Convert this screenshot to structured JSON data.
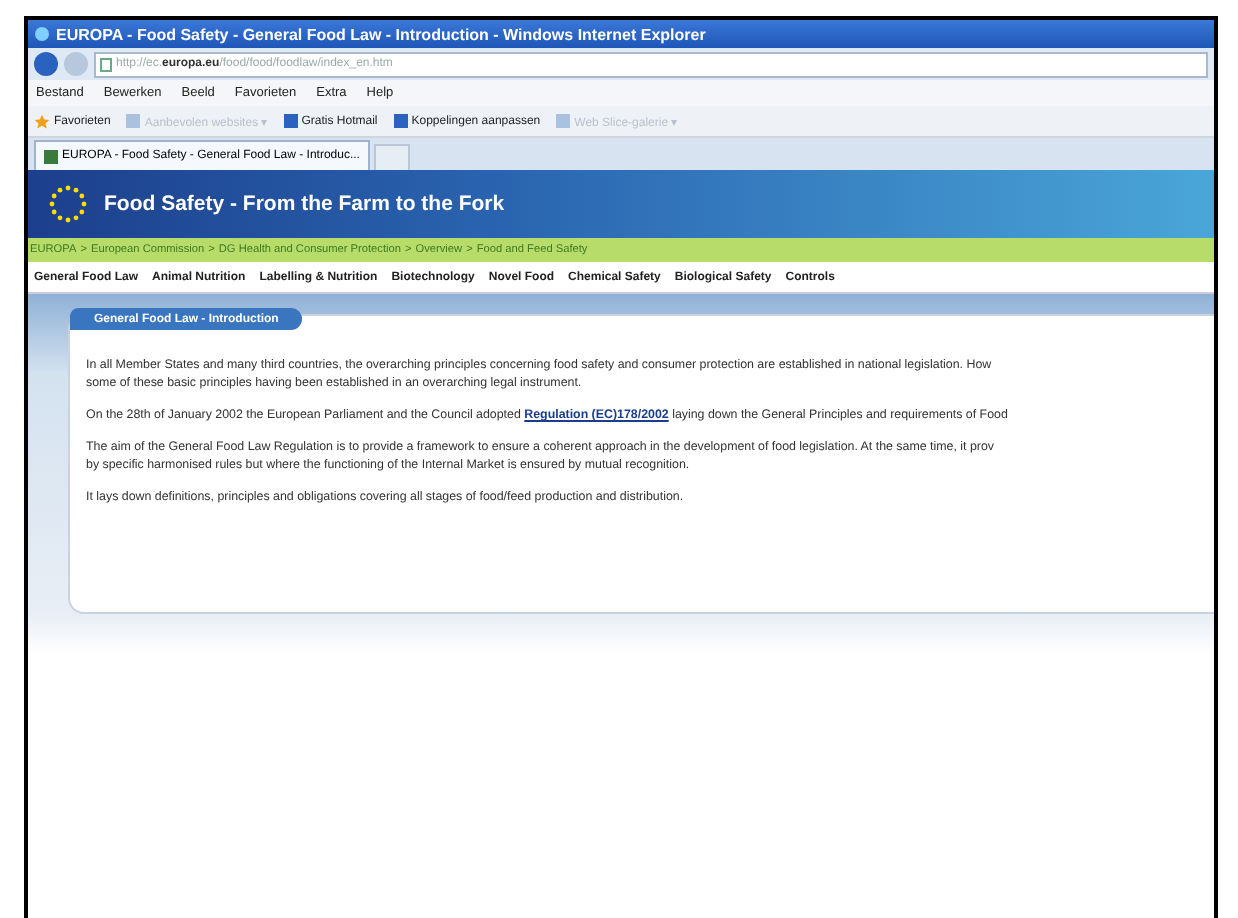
{
  "window": {
    "title": "EUROPA - Food Safety - General Food Law - Introduction - Windows Internet Explorer"
  },
  "address_bar": {
    "url_prefix": "http://ec.",
    "url_domain": "europa.eu",
    "url_path": "/food/food/foodlaw/index_en.htm"
  },
  "menu": [
    "Bestand",
    "Bewerken",
    "Beeld",
    "Favorieten",
    "Extra",
    "Help"
  ],
  "favorites_bar": [
    {
      "kind": "star",
      "label": "Favorieten"
    },
    {
      "kind": "faint",
      "label": "Aanbevolen websites ▾"
    },
    {
      "kind": "normal",
      "label": "Gratis Hotmail"
    },
    {
      "kind": "normal",
      "label": "Koppelingen aanpassen"
    },
    {
      "kind": "faint",
      "label": "Web Slice-galerie ▾"
    }
  ],
  "tabs": [
    {
      "label": "EUROPA - Food Safety - General Food Law - Introduc...",
      "selected": true
    }
  ],
  "banner": {
    "title": "Food Safety - From the Farm to the Fork"
  },
  "breadcrumb": [
    "EUROPA",
    ">",
    "European Commission",
    ">",
    "DG Health and Consumer Protection",
    ">",
    "Overview",
    ">",
    "Food and Feed Safety"
  ],
  "nav": [
    "General Food Law",
    "Animal Nutrition",
    "Labelling & Nutrition",
    "Biotechnology",
    "Novel Food",
    "Chemical Safety",
    "Biological Safety",
    "Controls"
  ],
  "panel": {
    "title": "General Food Law - Introduction",
    "paragraphs": [
      {
        "lines": [
          "In all Member States and many third countries, the overarching principles concerning food safety and consumer protection are established in national legislation. How",
          "some of these basic principles having been established in an overarching legal instrument."
        ]
      },
      {
        "lines": [
          "On the 28th of January 2002 the European Parliament and the Council adopted ",
          "Regulation (EC)178/2002",
          " laying down the General Principles and requirements of Food"
        ],
        "kind": "link"
      },
      {
        "lines": [
          "The aim of the General Food Law Regulation is to provide a framework to ensure a coherent approach in the development of food legislation. At the same time, it prov",
          "by specific harmonised rules but where the functioning of the Internal Market is ensured by mutual recognition."
        ]
      },
      {
        "lines": [
          "It lays down definitions, principles and obligations covering all stages of food/feed production and distribution."
        ]
      }
    ]
  }
}
